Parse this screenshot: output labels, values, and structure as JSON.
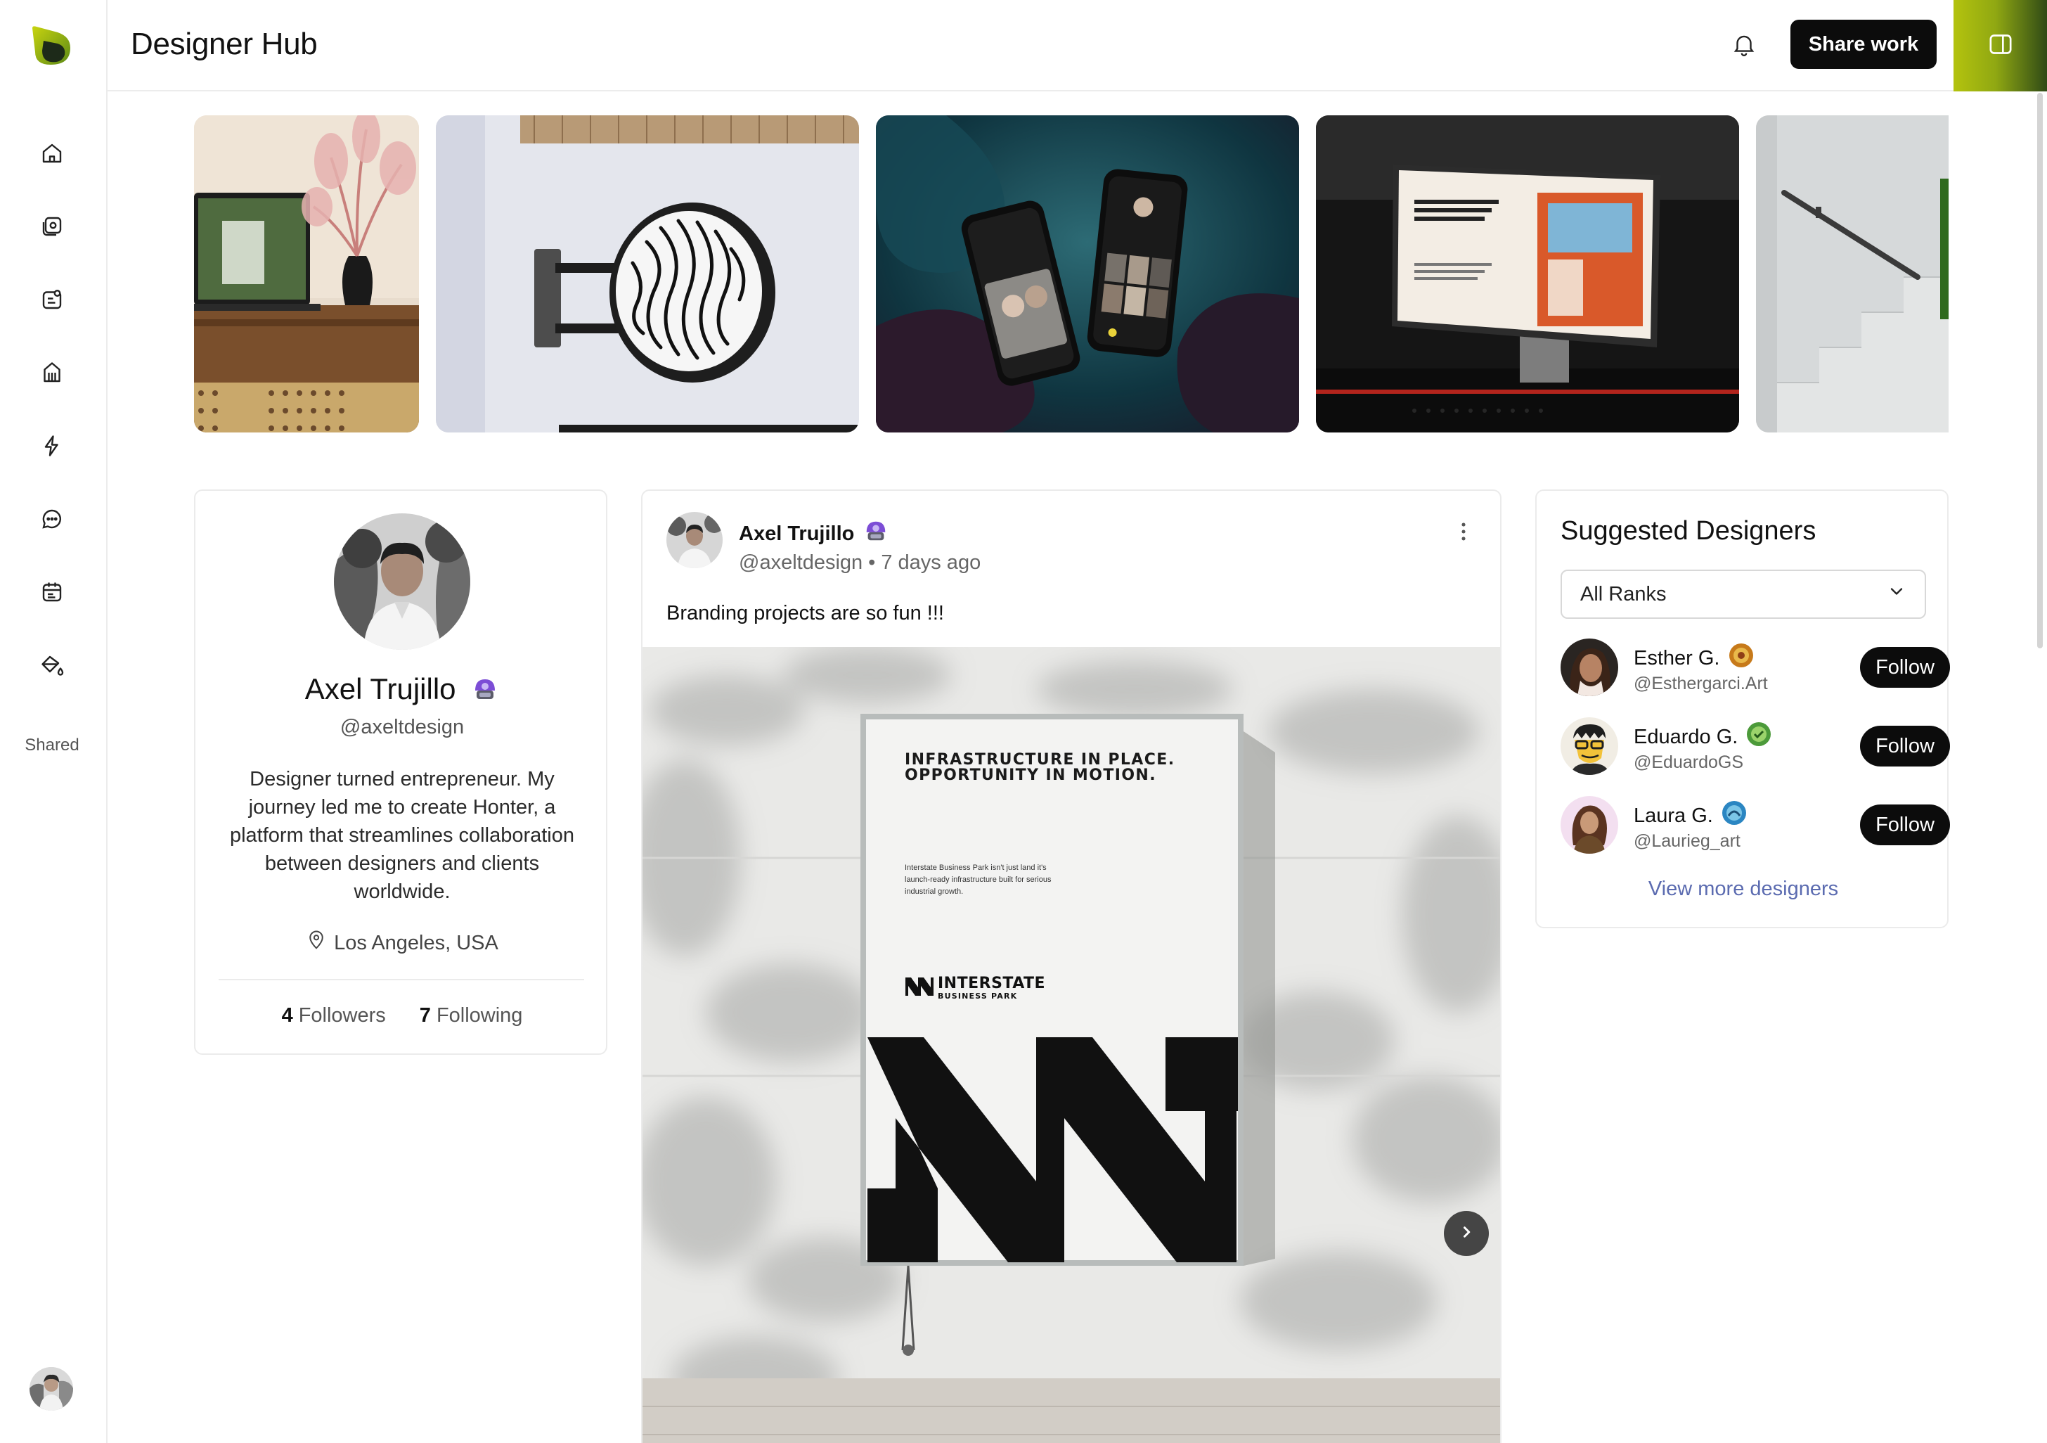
{
  "app": {
    "title": "Designer Hub"
  },
  "topbar": {
    "share_label": "Share work",
    "notification_icon": "bell-icon",
    "panel_icon": "sidebar-toggle-icon",
    "accent_gradient": [
      "#b4c30e",
      "#2f4a16"
    ]
  },
  "sidebar": {
    "items": [
      {
        "name": "home",
        "icon": "home-icon"
      },
      {
        "name": "gallery",
        "icon": "gallery-icon"
      },
      {
        "name": "tasks",
        "icon": "tasks-icon"
      },
      {
        "name": "landmark",
        "icon": "landmark-icon"
      },
      {
        "name": "activity",
        "icon": "lightning-icon"
      },
      {
        "name": "messages",
        "icon": "chat-icon"
      },
      {
        "name": "calendar",
        "icon": "calendar-icon"
      },
      {
        "name": "paint",
        "icon": "paint-bucket-icon"
      }
    ],
    "shared_label": "Shared"
  },
  "gallery": {
    "tiles": [
      {
        "name": "laptop-and-vase",
        "colors": [
          "#6b4a2c",
          "#c58f82"
        ]
      },
      {
        "name": "fingerprint-sign",
        "colors": [
          "#dfe2ea",
          "#1a1a1a"
        ]
      },
      {
        "name": "phone-mockups",
        "colors": [
          "#103b44",
          "#2b1e2e"
        ]
      },
      {
        "name": "monitor-homepage",
        "colors": [
          "#1b1b1b",
          "#d25a2a"
        ]
      },
      {
        "name": "concrete-staircase",
        "colors": [
          "#cfd3d5",
          "#3f7a24"
        ]
      }
    ]
  },
  "profile": {
    "name": "Axel Trujillo",
    "handle": "@axeltdesign",
    "bio": "Designer turned entrepreneur. My journey led me to create Honter, a platform that streamlines collaboration between designers and clients worldwide.",
    "location": "Los Angeles, USA",
    "followers_count": "4",
    "followers_label": "Followers",
    "following_count": "7",
    "following_label": "Following",
    "rank_badge_color": "#7c4dd6"
  },
  "post": {
    "author": "Axel Trujillo",
    "handle": "@axeltdesign",
    "separator": "•",
    "time_ago": "7 days ago",
    "text": "Branding projects are so fun !!!",
    "poster": {
      "headline": "INFRASTRUCTURE IN PLACE. OPPORTUNITY IN MOTION.",
      "body": "Interstate Business Park isn't just land it's launch-ready infrastructure built for serious industrial growth.",
      "brand": "INTERSTATE",
      "brand_sub": "BUSINESS PARK"
    }
  },
  "suggested": {
    "title": "Suggested Designers",
    "filter_value": "All Ranks",
    "designers": [
      {
        "name": "Esther G.",
        "handle": "@Esthergarci.Art",
        "follow_label": "Follow",
        "badge_color": "#c77a1a"
      },
      {
        "name": "Eduardo G.",
        "handle": "@EduardoGS",
        "follow_label": "Follow",
        "badge_color": "#4c9a3a"
      },
      {
        "name": "Laura G.",
        "handle": "@Laurieg_art",
        "follow_label": "Follow",
        "badge_color": "#2b86c2"
      }
    ],
    "more_label": "View more designers"
  }
}
